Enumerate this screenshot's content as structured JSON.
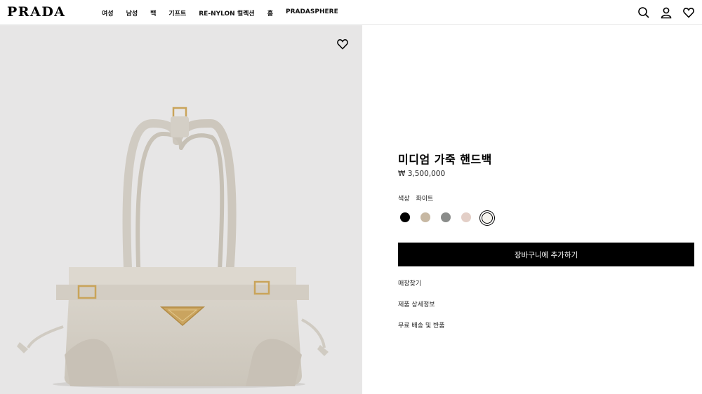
{
  "header": {
    "logo": "PRADA",
    "nav": [
      "여성",
      "남성",
      "백",
      "기프트",
      "RE-NYLON 컬렉션",
      "홈",
      "PRADASPHERE"
    ],
    "icons": [
      "search-icon",
      "account-icon",
      "wishlist-icon"
    ]
  },
  "product": {
    "title": "미디엄 가죽 핸드백",
    "price": "₩ 3,500,000",
    "color_label": "색상",
    "color_value": "화이트",
    "swatches": [
      {
        "name": "black",
        "color": "#000000"
      },
      {
        "name": "tan",
        "color": "#c7b8a3"
      },
      {
        "name": "grey",
        "color": "#8a8c8a"
      },
      {
        "name": "pink",
        "color": "#e3cfc7"
      },
      {
        "name": "white",
        "color": "#f6f4ef",
        "selected": true
      }
    ],
    "add_to_cart": "장바구니에 추가하기",
    "links": [
      "매장찾기",
      "제품 상세정보",
      "무료 배송 및 반품"
    ]
  },
  "colors": {
    "image_bg": "#e7e6e6",
    "bag": "#d8d3ca",
    "accent": "#000000"
  }
}
